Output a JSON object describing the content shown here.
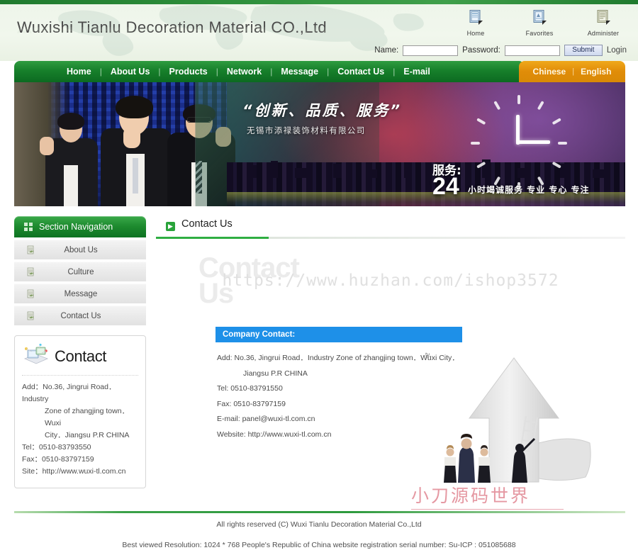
{
  "site": {
    "company_name": "Wuxishi Tianlu Decoration Material CO.,Ltd"
  },
  "header": {
    "quicklinks": [
      {
        "label": "Home",
        "icon": "home-window-icon"
      },
      {
        "label": "Favorites",
        "icon": "favorites-window-icon"
      },
      {
        "label": "Administer",
        "icon": "administer-window-icon"
      }
    ],
    "login": {
      "name_label": "Name:",
      "name_value": "",
      "name_placeholder": "",
      "password_label": "Password:",
      "password_value": "",
      "password_placeholder": "",
      "submit_label": "Submit",
      "login_label": "Login"
    }
  },
  "nav": {
    "separator": "|",
    "items": [
      {
        "label": "Home"
      },
      {
        "label": "About Us"
      },
      {
        "label": "Products"
      },
      {
        "label": "Network"
      },
      {
        "label": "Message"
      },
      {
        "label": "Contact Us"
      },
      {
        "label": "E-mail"
      }
    ],
    "languages": [
      {
        "label": "Chinese"
      },
      {
        "label": "English"
      }
    ],
    "lang_separator": "|"
  },
  "banner": {
    "slogan": "“创新、品质、服务”",
    "subslogan": "无锡市添禄装饰材料有限公司",
    "service_label": "服务:",
    "service_number": "24",
    "service_text": "小时竭诚服务 专业 专心 专注"
  },
  "sidebar": {
    "section_title": "Section Navigation",
    "section_icon": "squares-icon",
    "items": [
      {
        "label": "About Us",
        "icon": "page-arrow-icon"
      },
      {
        "label": "Culture",
        "icon": "page-arrow-icon"
      },
      {
        "label": "Message",
        "icon": "page-arrow-icon"
      },
      {
        "label": "Contact Us",
        "icon": "page-arrow-icon"
      }
    ],
    "contact_card": {
      "title": "Contact",
      "icon": "contact-book-icon",
      "line_add_1": "Add：No.36, Jingrui Road．Industry",
      "line_add_2": "Zone of zhangjing town．Wuxi",
      "line_add_3": "City．Jiangsu P.R CHINA",
      "line_tel": "Tel：0510-83793550",
      "line_fax": "Fax：0510-83797159",
      "line_site": "Site：http://www.wuxi-tl.com.cn"
    }
  },
  "main": {
    "page_title": "Contact Us",
    "page_title_icon": "arrow-right-icon",
    "ghost_watermark_line1": "Contact",
    "ghost_watermark_line2": "Us",
    "url_watermark": "https://www.huzhan.com/ishop3572",
    "red_watermark": "小刀源码世界",
    "company_contact_heading": "Company Contact:",
    "details": {
      "add_line1": "Add: No.36, Jingrui Road．Industry Zone of zhangjing town．Wuxi City．",
      "add_line2": "Jiangsu P.R CHINA",
      "tel": "Tel: 0510-83791550",
      "fax": "Fax: 0510-83797159",
      "email": "E-mail: panel@wuxi-tl.com.cn",
      "website": "Website: http://www.wuxi-tl.com.cn"
    }
  },
  "footer": {
    "line1": "All rights reserved (C) Wuxi Tianlu Decoration Material Co.,Ltd",
    "line2": "Best viewed Resolution: 1024 * 768 People's Republic of China website registration serial number: Su-ICP : 051085688"
  },
  "colors": {
    "nav_green": "#17802b",
    "lang_orange": "#e08c08",
    "accent_green": "#2fae42",
    "blue_bar": "#1e90e8",
    "header_bg": "#eef5ea"
  }
}
